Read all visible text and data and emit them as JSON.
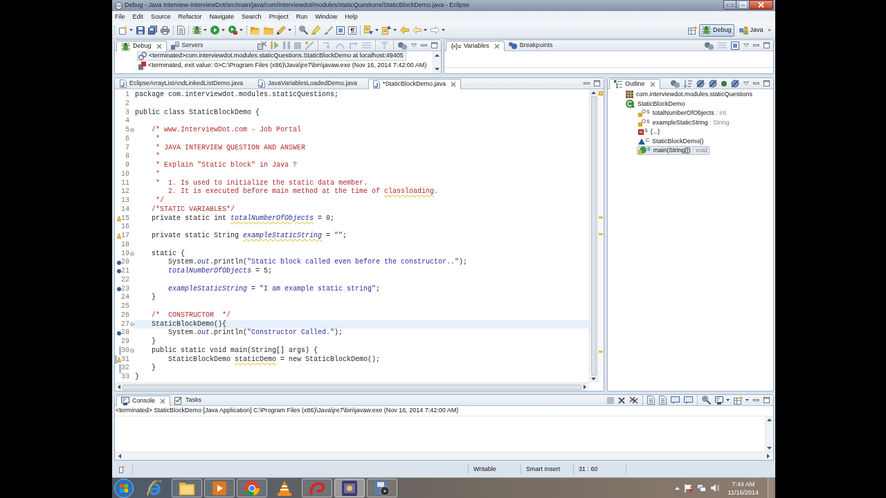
{
  "window": {
    "title": "Debug - Java Interview-InterviewDot/src/main/java/com/interviewdot/modules/staticQuestions/StaticBlockDemo.java - Eclipse"
  },
  "menu": [
    "File",
    "Edit",
    "Source",
    "Refactor",
    "Navigate",
    "Search",
    "Project",
    "Run",
    "Window",
    "Help"
  ],
  "perspectives": {
    "items": [
      {
        "label": "Debug",
        "selected": true
      },
      {
        "label": "Java",
        "selected": false
      }
    ],
    "overflow": "»"
  },
  "debug_view": {
    "tabs": [
      {
        "label": "Debug",
        "selected": true
      },
      {
        "label": "Servers",
        "selected": false
      }
    ],
    "items": [
      {
        "kind": "target",
        "label": "<terminated>com.interviewdot.modules.staticQuestions.StaticBlockDemo at localhost:49405",
        "selected": true
      },
      {
        "kind": "process",
        "label": "<terminated, exit value: 0>C:\\Program Files (x86)\\Java\\jre7\\bin\\javaw.exe (Nov 16, 2014 7:42:00 AM)",
        "selected": false
      }
    ]
  },
  "variables_view": {
    "tabs": [
      {
        "label": "Variables",
        "selected": true
      },
      {
        "label": "Breakpoints",
        "selected": false
      }
    ]
  },
  "editor": {
    "tabs": [
      {
        "label": "EclipseArrayListAndLinkedListDemo.java",
        "selected": false
      },
      {
        "label": "JavaVariablesLoadedDemo.java",
        "selected": false
      },
      {
        "label": "*StaticBlockDemo.java",
        "selected": true
      }
    ],
    "lines": [
      {
        "number": "1",
        "fold": false,
        "current": false,
        "tokens": [
          {
            "text": "package com.interviewdot.modules.staticQuestions;",
            "kind": "plain"
          }
        ]
      },
      {
        "number": "2",
        "fold": false,
        "current": false
      },
      {
        "number": "3",
        "fold": false,
        "current": false,
        "tokens": [
          {
            "text": "public class StaticBlockDemo {",
            "kind": "plain"
          }
        ]
      },
      {
        "number": "4",
        "fold": false,
        "current": false
      },
      {
        "number": "5",
        "fold": true,
        "current": false,
        "tokens": [
          {
            "text": "    /* www.InterviewDot.com - Job Portal",
            "kind": "comment"
          }
        ]
      },
      {
        "number": "6",
        "fold": false,
        "current": false,
        "tokens": [
          {
            "text": "     *",
            "kind": "comment"
          }
        ]
      },
      {
        "number": "7",
        "fold": false,
        "current": false,
        "tokens": [
          {
            "text": "     * JAVA INTERVIEW QUESTION AND ANSWER",
            "kind": "comment"
          }
        ]
      },
      {
        "number": "8",
        "fold": false,
        "current": false,
        "tokens": [
          {
            "text": "     *",
            "kind": "comment"
          }
        ]
      },
      {
        "number": "9",
        "fold": false,
        "current": false,
        "tokens": [
          {
            "text": "     * Explain \"Static block\" in Java ?",
            "kind": "comment"
          }
        ]
      },
      {
        "number": "10",
        "fold": false,
        "current": false,
        "tokens": [
          {
            "text": "     *",
            "kind": "comment"
          }
        ]
      },
      {
        "number": "11",
        "fold": false,
        "current": false,
        "tokens": [
          {
            "text": "     *  1. Is used to initialize the static data member.",
            "kind": "comment"
          }
        ]
      },
      {
        "number": "12",
        "fold": false,
        "current": false,
        "tokens": [
          {
            "text": "        2. It is executed before main method at the time of ",
            "kind": "comment"
          },
          {
            "text": "classloading",
            "kind": "comment_warning"
          },
          {
            "text": ".",
            "kind": "comment"
          }
        ]
      },
      {
        "number": "13",
        "fold": false,
        "current": false,
        "tokens": [
          {
            "text": "     */",
            "kind": "comment"
          }
        ]
      },
      {
        "number": "14",
        "fold": false,
        "current": false,
        "tokens": [
          {
            "text": "    /*STATIC VARIABLES*/",
            "kind": "comment"
          }
        ]
      },
      {
        "number": "15",
        "fold": false,
        "current": false,
        "markers": [
          {
            "kind": "warning"
          }
        ],
        "tokens": [
          {
            "text": "    private static int ",
            "kind": "plain"
          },
          {
            "text": "totalNumberOfObjects",
            "kind": "field_warning"
          },
          {
            "text": " = 0;",
            "kind": "plain"
          }
        ]
      },
      {
        "number": "16",
        "fold": false,
        "current": false
      },
      {
        "number": "17",
        "fold": false,
        "current": false,
        "markers": [
          {
            "kind": "warning"
          }
        ],
        "tokens": [
          {
            "text": "    private static String ",
            "kind": "plain"
          },
          {
            "text": "exampleStaticString",
            "kind": "field_warning"
          },
          {
            "text": " = ",
            "kind": "plain"
          },
          {
            "text": "\"\"",
            "kind": "string"
          },
          {
            "text": ";",
            "kind": "plain"
          }
        ]
      },
      {
        "number": "18",
        "fold": false,
        "current": false
      },
      {
        "number": "19",
        "fold": true,
        "current": false,
        "tokens": [
          {
            "text": "    static {",
            "kind": "plain"
          }
        ]
      },
      {
        "number": "20",
        "fold": false,
        "current": false,
        "markers": [
          {
            "kind": "breakpoint"
          }
        ],
        "tokens": [
          {
            "text": "        System.",
            "kind": "plain"
          },
          {
            "text": "out",
            "kind": "field"
          },
          {
            "text": ".println(",
            "kind": "plain"
          },
          {
            "text": "\"Static block called even before the constructor..\"",
            "kind": "string"
          },
          {
            "text": ");",
            "kind": "plain"
          }
        ]
      },
      {
        "number": "21",
        "fold": false,
        "current": false,
        "markers": [
          {
            "kind": "breakpoint"
          }
        ],
        "tokens": [
          {
            "text": "        totalNumberOfObjects",
            "kind": "field"
          },
          {
            "text": " = 5;",
            "kind": "plain"
          }
        ]
      },
      {
        "number": "22",
        "fold": false,
        "current": false
      },
      {
        "number": "23",
        "fold": false,
        "current": false,
        "markers": [
          {
            "kind": "breakpoint"
          }
        ],
        "tokens": [
          {
            "text": "        exampleStaticString",
            "kind": "field"
          },
          {
            "text": " = ",
            "kind": "plain"
          },
          {
            "text": "\"I am example static string\"",
            "kind": "string"
          },
          {
            "text": ";",
            "kind": "plain"
          }
        ]
      },
      {
        "number": "24",
        "fold": false,
        "current": false,
        "tokens": [
          {
            "text": "    }",
            "kind": "plain"
          }
        ]
      },
      {
        "number": "25",
        "fold": false,
        "current": false
      },
      {
        "number": "26",
        "fold": false,
        "current": false,
        "tokens": [
          {
            "text": "    /*  CONSTRUCTOR  */",
            "kind": "comment"
          }
        ]
      },
      {
        "number": "27",
        "fold": true,
        "current": true,
        "tokens": [
          {
            "text": "    StaticBlockDemo(){",
            "kind": "plain"
          }
        ]
      },
      {
        "number": "28",
        "fold": false,
        "current": false,
        "markers": [
          {
            "kind": "breakpoint"
          }
        ],
        "tokens": [
          {
            "text": "        System.",
            "kind": "plain"
          },
          {
            "text": "out",
            "kind": "field"
          },
          {
            "text": ".println(",
            "kind": "plain"
          },
          {
            "text": "\"Constructor Called.\"",
            "kind": "string"
          },
          {
            "text": ");",
            "kind": "plain"
          }
        ]
      },
      {
        "number": "29",
        "fold": false,
        "current": false,
        "tokens": [
          {
            "text": "    }",
            "kind": "plain"
          }
        ]
      },
      {
        "number": "30",
        "fold": true,
        "current": false,
        "markers": [
          {
            "kind": "change"
          }
        ],
        "tokens": [
          {
            "text": "    public static void main(String[] args) {",
            "kind": "plain"
          }
        ]
      },
      {
        "number": "31",
        "fold": false,
        "current": false,
        "markers": [
          {
            "kind": "change"
          },
          {
            "kind": "warning"
          }
        ],
        "tokens": [
          {
            "text": "        StaticBlockDemo ",
            "kind": "plain"
          },
          {
            "text": "staticDemo",
            "kind": "warning"
          },
          {
            "text": " = new StaticBlockDemo();",
            "kind": "plain"
          }
        ]
      },
      {
        "number": "32",
        "fold": false,
        "current": false,
        "markers": [
          {
            "kind": "change"
          }
        ],
        "tokens": [
          {
            "text": "    }",
            "kind": "plain"
          }
        ]
      },
      {
        "number": "33",
        "fold": false,
        "current": false,
        "tokens": [
          {
            "text": "}",
            "kind": "plain"
          }
        ]
      }
    ]
  },
  "outline": {
    "tabs": [
      {
        "label": "Outline",
        "selected": true
      }
    ],
    "items": [
      {
        "kind": "package",
        "label": "com.interviewdot.modules.staticQuestions",
        "selected": false
      },
      {
        "kind": "class",
        "label": "StaticBlockDemo",
        "selected": false,
        "children": [
          {
            "kind": "field",
            "badge": "S",
            "label": "totalNumberOfObjects",
            "type": ": int",
            "selected": false
          },
          {
            "kind": "field",
            "badge": "S",
            "label": "exampleStaticString",
            "type": ": String",
            "selected": false
          },
          {
            "kind": "initializer",
            "badge": "S",
            "label": "{...}",
            "selected": false
          },
          {
            "kind": "constructor",
            "badge": "C",
            "label": "StaticBlockDemo()",
            "selected": false
          },
          {
            "kind": "method",
            "badge": "S",
            "label": "main(String[])",
            "type": ": void",
            "selected": true
          }
        ]
      }
    ]
  },
  "console": {
    "tabs": [
      {
        "label": "Console",
        "selected": true
      },
      {
        "label": "Tasks",
        "selected": false
      }
    ],
    "header": "<terminated> StaticBlockDemo [Java Application] C:\\Program Files (x86)\\Java\\jre7\\bin\\javaw.exe (Nov 16, 2014 7:42:00 AM)"
  },
  "status_bar": [
    "Writable",
    "Smart Insert",
    "31 : 60"
  ],
  "taskbar": {
    "apps": [
      {
        "kind": "globe",
        "running": false,
        "selected": false
      },
      {
        "kind": "folder",
        "running": true,
        "selected": false
      },
      {
        "kind": "player",
        "running": true,
        "selected": false
      },
      {
        "kind": "browser",
        "running": true,
        "selected": false
      },
      {
        "kind": "cone",
        "running": false,
        "selected": false
      },
      {
        "kind": "swirl",
        "running": true,
        "selected": false
      },
      {
        "kind": "ide",
        "running": true,
        "selected": true
      },
      {
        "kind": "disk",
        "running": true,
        "selected": false
      }
    ],
    "time": "7:44 AM",
    "date": "11/16/2014"
  }
}
